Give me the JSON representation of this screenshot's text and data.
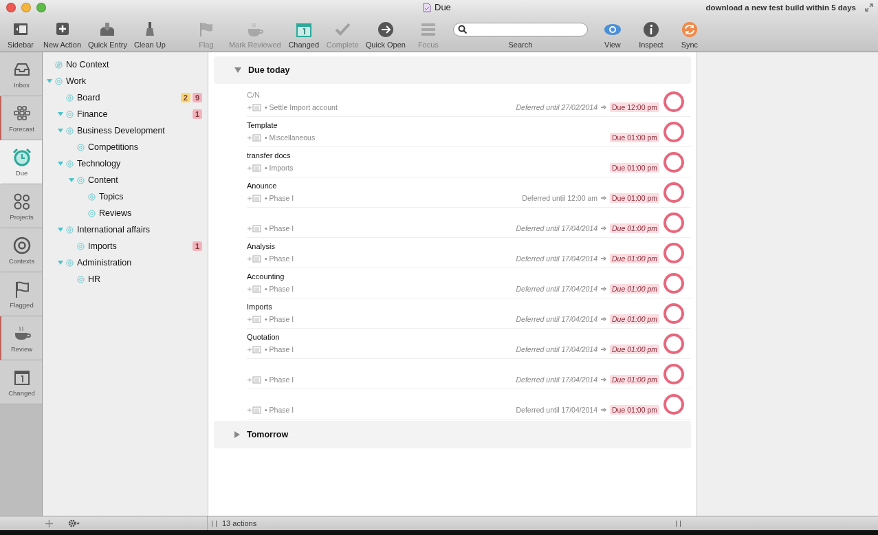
{
  "window": {
    "title": "Due",
    "notice": "download a new test build within 5 days"
  },
  "toolbar": [
    {
      "kind": "sidebar",
      "label": "Sidebar",
      "disabled": false
    },
    {
      "kind": "new",
      "label": "New Action",
      "disabled": false
    },
    {
      "kind": "quick-entry",
      "label": "Quick Entry",
      "disabled": false
    },
    {
      "kind": "clean",
      "label": "Clean Up",
      "disabled": false
    },
    {
      "kind": "flag",
      "label": "Flag",
      "disabled": true
    },
    {
      "kind": "review",
      "label": "Mark Reviewed",
      "disabled": true
    },
    {
      "kind": "changed",
      "label": "Changed",
      "disabled": false
    },
    {
      "kind": "complete",
      "label": "Complete",
      "disabled": true
    },
    {
      "kind": "open",
      "label": "Quick Open",
      "disabled": false
    },
    {
      "kind": "focus",
      "label": "Focus",
      "disabled": true
    },
    {
      "kind": "search",
      "label": "Search",
      "disabled": false
    },
    {
      "kind": "view",
      "label": "View",
      "disabled": false
    },
    {
      "kind": "inspect",
      "label": "Inspect",
      "disabled": false
    },
    {
      "kind": "sync",
      "label": "Sync",
      "disabled": false
    }
  ],
  "perspectives": [
    {
      "kind": "inbox",
      "label": "Inbox",
      "selected": false,
      "marked": false
    },
    {
      "kind": "forecast",
      "label": "Forecast",
      "selected": false,
      "marked": true
    },
    {
      "kind": "due",
      "label": "Due",
      "selected": true,
      "marked": false
    },
    {
      "kind": "projects",
      "label": "Projects",
      "selected": false,
      "marked": false
    },
    {
      "kind": "contexts",
      "label": "Contexts",
      "selected": false,
      "marked": false
    },
    {
      "kind": "flagged",
      "label": "Flagged",
      "selected": false,
      "marked": false
    },
    {
      "kind": "review",
      "label": "Review",
      "selected": false,
      "marked": true
    },
    {
      "kind": "changed",
      "label": "Changed",
      "selected": false,
      "marked": false
    }
  ],
  "contexts": [
    {
      "name": "No Context",
      "kind": "none"
    },
    {
      "name": "Work",
      "expanded": true,
      "children": [
        {
          "name": "Board",
          "badges": [
            {
              "text": "2",
              "color": "#f6d77a"
            },
            {
              "text": "9",
              "color": "#f3b3bd"
            }
          ]
        },
        {
          "name": "Finance",
          "expanded": true,
          "badges": [
            {
              "text": "1",
              "color": "#f3b3bd"
            }
          ]
        },
        {
          "name": "Business Development",
          "expanded": true,
          "children": [
            {
              "name": "Competitions"
            }
          ]
        },
        {
          "name": "Technology",
          "expanded": true,
          "children": [
            {
              "name": "Content",
              "expanded": true,
              "children": [
                {
                  "name": "Topics"
                },
                {
                  "name": "Reviews"
                }
              ]
            }
          ]
        },
        {
          "name": "International affairs",
          "expanded": true,
          "children": [
            {
              "name": "Imports",
              "badges": [
                {
                  "text": "1",
                  "color": "#f3b3bd"
                }
              ]
            }
          ]
        },
        {
          "name": "Administration",
          "expanded": true,
          "children": [
            {
              "name": "HR"
            }
          ]
        }
      ]
    }
  ],
  "groups": [
    {
      "title": "Due today",
      "expanded": true,
      "actions": [
        {
          "title": "C/N",
          "muted": true,
          "project": "• Settle Import account",
          "deferred": "Deferred until 27/02/2014",
          "due": "Due 12:00 pm",
          "italic": true,
          "due_italic": false
        },
        {
          "title": "Template",
          "muted": false,
          "project": "• Miscellaneous",
          "due": "Due 01:00 pm",
          "due_italic": false
        },
        {
          "title": "transfer docs",
          "muted": false,
          "project": "• Imports",
          "due": "Due 01:00 pm",
          "due_italic": false
        },
        {
          "title": "Anounce",
          "muted": false,
          "project": "• Phase I",
          "deferred": "Deferred until 12:00 am",
          "due": "Due 01:00 pm",
          "italic": false,
          "due_italic": false
        },
        {
          "project": "• Phase I",
          "deferred": "Deferred until 17/04/2014",
          "due": "Due 01:00 pm",
          "italic": true,
          "due_italic": true
        },
        {
          "title": "Analysis",
          "muted": false,
          "project": "• Phase I",
          "deferred": "Deferred until 17/04/2014",
          "due": "Due 01:00 pm",
          "italic": true,
          "due_italic": true
        },
        {
          "title": "Accounting",
          "muted": false,
          "project": "• Phase I",
          "deferred": "Deferred until 17/04/2014",
          "due": "Due 01:00 pm",
          "italic": true,
          "due_italic": true
        },
        {
          "title": "Imports",
          "muted": false,
          "project": "• Phase I",
          "deferred": "Deferred until 17/04/2014",
          "due": "Due 01:00 pm",
          "italic": true,
          "due_italic": true
        },
        {
          "title": "Quotation",
          "muted": false,
          "project": "• Phase I",
          "deferred": "Deferred until 17/04/2014",
          "due": "Due 01:00 pm",
          "italic": true,
          "due_italic": true
        },
        {
          "project": "• Phase I",
          "deferred": "Deferred until 17/04/2014",
          "due": "Due 01:00 pm",
          "italic": true,
          "due_italic": true
        },
        {
          "project": "• Phase I",
          "deferred": "Deferred until 17/04/2014",
          "due": "Due 01:00 pm",
          "italic": false,
          "due_italic": false
        }
      ]
    },
    {
      "title": "Tomorrow",
      "expanded": false
    }
  ],
  "status_bar": {
    "count": "13 actions"
  }
}
